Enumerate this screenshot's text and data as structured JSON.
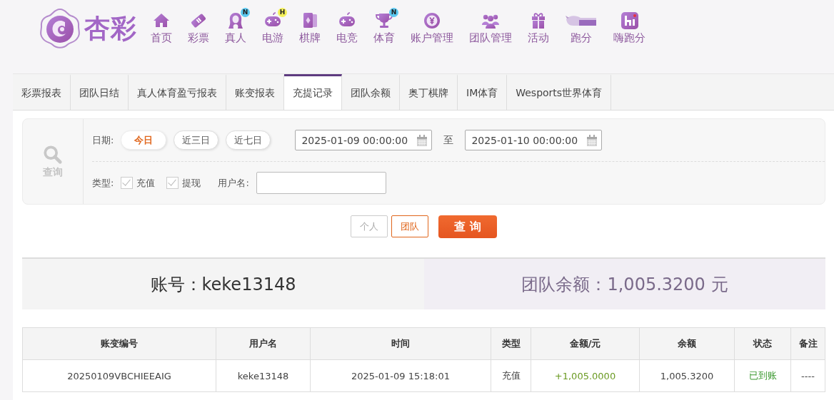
{
  "logo": {
    "text": "杏彩"
  },
  "nav": [
    {
      "label": "首页",
      "kind": "home"
    },
    {
      "label": "彩票",
      "kind": "ticket"
    },
    {
      "label": "真人",
      "kind": "lady",
      "badge": {
        "text": "N",
        "color": "#5bc8f0"
      }
    },
    {
      "label": "电游",
      "kind": "gamepad",
      "badge": {
        "text": "H",
        "color": "#f4f05a"
      }
    },
    {
      "label": "棋牌",
      "kind": "cards"
    },
    {
      "label": "电竞",
      "kind": "gamepad"
    },
    {
      "label": "体育",
      "kind": "trophy",
      "badge": {
        "text": "N",
        "color": "#5bc8f0"
      }
    },
    {
      "label": "账户管理",
      "kind": "coin"
    },
    {
      "label": "团队管理",
      "kind": "group"
    },
    {
      "label": "活动",
      "kind": "gift"
    },
    {
      "label": "跑分",
      "kind": "rhino"
    },
    {
      "label": "嗨跑分",
      "kind": "app"
    }
  ],
  "tabs": [
    {
      "label": "彩票报表",
      "selected": false
    },
    {
      "label": "团队日结",
      "selected": false
    },
    {
      "label": "真人体育盈亏报表",
      "selected": false
    },
    {
      "label": "账变报表",
      "selected": false
    },
    {
      "label": "充提记录",
      "selected": true
    },
    {
      "label": "团队余额",
      "selected": false
    },
    {
      "label": "奥丁棋牌",
      "selected": false
    },
    {
      "label": "IM体育",
      "selected": false
    },
    {
      "label": "Wesports世界体育",
      "selected": false
    }
  ],
  "filter": {
    "side_label": "查询",
    "date_label": "日期:",
    "quick_ranges": [
      {
        "label": "今日",
        "selected": true
      },
      {
        "label": "近三日",
        "selected": false
      },
      {
        "label": "近七日",
        "selected": false
      }
    ],
    "date_from": "2025-01-09 00:00:00",
    "to_label": "至",
    "date_to": "2025-01-10 00:00:00",
    "type_label": "类型:",
    "types": [
      {
        "label": "充值",
        "checked": true
      },
      {
        "label": "提现",
        "checked": true
      }
    ],
    "username_label": "用户名:"
  },
  "scope": [
    {
      "label": "个人",
      "selected": false
    },
    {
      "label": "团队",
      "selected": true
    }
  ],
  "search_button": "查 询",
  "summary": {
    "account": "账号：keke13148",
    "team_balance": "团队余额：1,005.3200 元"
  },
  "table": {
    "columns": [
      "账变编号",
      "用户名",
      "时间",
      "类型",
      "金额/元",
      "余额",
      "状态",
      "备注"
    ],
    "rows": [
      {
        "cells": [
          "20250109VBCHIEEAIG",
          "keke13148",
          "2025-01-09 15:18:01",
          "充值",
          "+1,005.0000",
          "1,005.3200",
          "已到账",
          "----"
        ],
        "kind": "done"
      }
    ]
  }
}
